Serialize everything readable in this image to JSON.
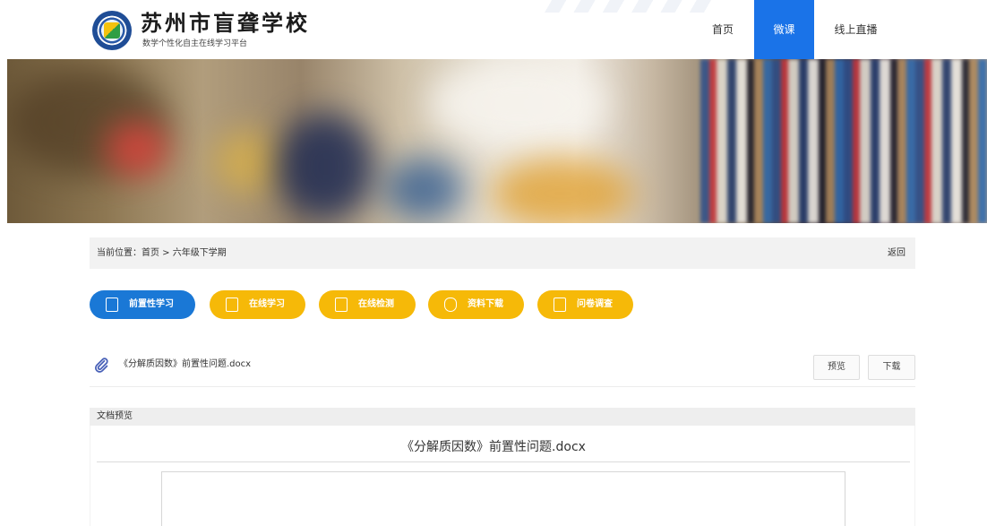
{
  "header": {
    "site_title": "苏州市盲聋学校",
    "site_subtitle": "数学个性化自主在线学习平台",
    "nav": [
      {
        "label": "首页",
        "active": false
      },
      {
        "label": "微课",
        "active": true
      },
      {
        "label": "线上直播",
        "active": false
      }
    ],
    "active_color": "#1a73e8"
  },
  "breadcrumb": {
    "label": "当前位置：",
    "path": "首页 > 六年级下学期",
    "back": "返回"
  },
  "tabs": [
    {
      "label": "前置性学习",
      "icon": "clipboard-check-icon",
      "active": true,
      "color": "#1a78d6"
    },
    {
      "label": "在线学习",
      "icon": "clipboard-check-icon",
      "active": false,
      "color": "#f6b908"
    },
    {
      "label": "在线检测",
      "icon": "document-lines-icon",
      "active": false,
      "color": "#f6b908"
    },
    {
      "label": "资料下载",
      "icon": "shield-download-icon",
      "active": false,
      "color": "#f6b908"
    },
    {
      "label": "问卷调查",
      "icon": "scroll-icon",
      "active": false,
      "color": "#f6b908"
    }
  ],
  "file": {
    "name": "《分解质因数》前置性问题.docx",
    "icon": "paperclip-icon",
    "preview_label": "预览",
    "download_label": "下载"
  },
  "preview": {
    "heading": "文档预览",
    "doc_title": "《分解质因数》前置性问题.docx"
  }
}
